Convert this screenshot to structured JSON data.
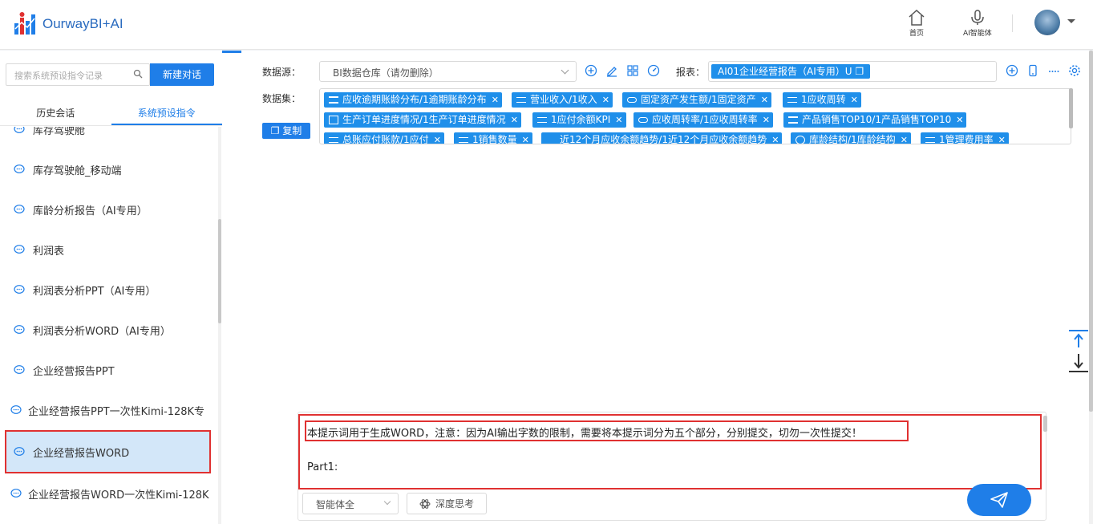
{
  "app": {
    "title": "OurwayBI+AI"
  },
  "top_nav": [
    {
      "label": "首页",
      "icon": "home-icon"
    },
    {
      "label": "AI智能体",
      "icon": "microphone-icon"
    }
  ],
  "sidebar": {
    "search_placeholder": "搜索系统预设指令记录",
    "new_button": "新建对话",
    "tabs": [
      "历史会话",
      "系统预设指令"
    ],
    "active_tab": 1,
    "items": [
      "库存驾驶舱",
      "库存驾驶舱_移动端",
      "库龄分析报告（AI专用）",
      "利润表",
      "利润表分析PPT（AI专用）",
      "利润表分析WORD（AI专用）",
      "企业经营报告PPT",
      "企业经营报告PPT一次性Kimi-128K专",
      "企业经营报告WORD",
      "企业经营报告WORD一次性Kimi-128K"
    ],
    "selected_index": 8
  },
  "toolbar": {
    "datasource_label": "数据源：",
    "datasource_value": "BI数据仓库（请勿删除）",
    "report_label": "报表：",
    "report_value": "AI01企业经营报告（AI专用）U",
    "dataset_label": "数据集：",
    "copy_button": "复制"
  },
  "datasets": [
    {
      "label": "应收逾期账龄分布/1逾期账龄分布",
      "icon": "list-icon"
    },
    {
      "label": "营业收入/1收入",
      "icon": "kpi-icon"
    },
    {
      "label": "固定资产发生额/1固定资产",
      "icon": "link-icon"
    },
    {
      "label": "1应收周转",
      "icon": "kpi-icon"
    },
    {
      "label": "生产订单进度情况/1生产订单进度情况",
      "icon": "table-icon"
    },
    {
      "label": "1应付余额KPI",
      "icon": "kpi-icon"
    },
    {
      "label": "应收周转率/1应收周转率",
      "icon": "link-icon"
    },
    {
      "label": "产品销售TOP10/1产品销售TOP10",
      "icon": "list-icon"
    },
    {
      "label": "总账应付账款/1应付",
      "icon": "kpi-icon"
    },
    {
      "label": "1销售数量",
      "icon": "kpi-icon"
    },
    {
      "label": "近12个月应收余额趋势/1近12个月应收余额趋势",
      "icon": "line-icon"
    },
    {
      "label": "库龄结构/1库龄结构",
      "icon": "pie-icon"
    },
    {
      "label": "1管理费用率",
      "icon": "kpi-icon"
    }
  ],
  "chat_input": {
    "line1": "本提示词用于生成WORD，注意：因为AI输出字数的限制，需要将本提示词分为五个部分，分别提交，切勿一次性提交！",
    "line2": "Part1:",
    "mode": "智能体全",
    "deep_think": "深度思考"
  }
}
